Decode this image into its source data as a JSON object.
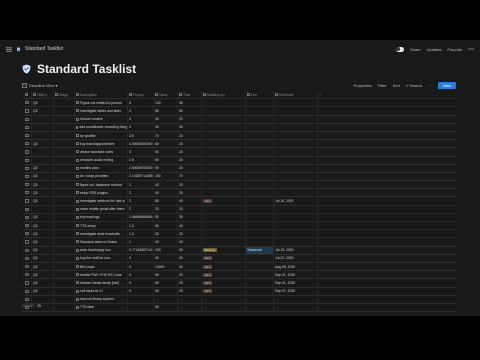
{
  "topbar": {
    "page_name": "Standard Tasklist",
    "share": "Share",
    "updates": "Updates",
    "favorite": "Favorite"
  },
  "title": "Standard Tasklist",
  "viewbar": {
    "view_name": "Deadline View",
    "properties": "Properties",
    "filter": "Filter",
    "sort": "Sort",
    "search": "Search",
    "new": "New"
  },
  "columns": {
    "check": "",
    "object": "Object",
    "stage": "Stage",
    "desc": "Description",
    "priority": "Priority",
    "value": "Value",
    "time": "Time",
    "modified": "Modified pri",
    "due": "Due",
    "reminder": "Reminder"
  },
  "rows": [
    {
      "checked": false,
      "object": "Q3",
      "stage": "",
      "desc": "Figure out related to journal",
      "priority": "5",
      "value": "100",
      "time": "35",
      "modified": "",
      "due": "",
      "reminder": "",
      "tag": ""
    },
    {
      "checked": false,
      "object": "Q3",
      "stage": "",
      "desc": "investigate tables and stats",
      "priority": "2",
      "value": "80",
      "time": "60",
      "modified": "",
      "due": "",
      "reminder": "",
      "tag": ""
    },
    {
      "checked": false,
      "object": "",
      "stage": "",
      "desc": "Unlock content",
      "priority": "4",
      "value": "40",
      "time": "20",
      "modified": "",
      "due": "",
      "reminder": "",
      "tag": ""
    },
    {
      "checked": false,
      "object": "",
      "stage": "",
      "desc": "add social/lower recording thing",
      "priority": "4",
      "value": "40",
      "time": "30",
      "modified": "",
      "due": "",
      "reminder": "",
      "tag": ""
    },
    {
      "checked": false,
      "object": "",
      "stage": "",
      "desc": "try spotlite",
      "priority": "3.5",
      "value": "70",
      "time": "20",
      "modified": "",
      "due": "",
      "reminder": "",
      "tag": ""
    },
    {
      "checked": false,
      "object": "Q3",
      "stage": "",
      "desc": "buy travel/appointment",
      "priority": "3.00000000000",
      "value": "60",
      "time": "20",
      "modified": "",
      "due": "",
      "reminder": "",
      "tag": ""
    },
    {
      "checked": false,
      "object": "",
      "stage": "",
      "desc": "weave standard notes",
      "priority": "3",
      "value": "60",
      "time": "20",
      "modified": "",
      "due": "",
      "reminder": "",
      "tag": ""
    },
    {
      "checked": false,
      "object": "",
      "stage": "",
      "desc": "research audio mixing",
      "priority": "2.5",
      "value": "50",
      "time": "20",
      "modified": "",
      "due": "",
      "reminder": "",
      "tag": ""
    },
    {
      "checked": false,
      "object": "Q3",
      "stage": "",
      "desc": "months plan",
      "priority": "2.50000000000",
      "value": "50",
      "time": "20",
      "modified": "",
      "due": "",
      "reminder": "",
      "tag": ""
    },
    {
      "checked": false,
      "object": "Q3",
      "stage": "",
      "desc": "do i swap priorities",
      "priority": "2.14285714285",
      "value": "150",
      "time": "70",
      "modified": "",
      "due": "",
      "reminder": "",
      "tag": ""
    },
    {
      "checked": false,
      "object": "Q3",
      "stage": "",
      "desc": "figure out Japanese content",
      "priority": "2",
      "value": "40",
      "time": "20",
      "modified": "",
      "due": "",
      "reminder": "",
      "tag": ""
    },
    {
      "checked": false,
      "object": "Q3",
      "stage": "",
      "desc": "setup RSS plugins",
      "priority": "2",
      "value": "40",
      "time": "20",
      "modified": "",
      "due": "",
      "reminder": "",
      "tag": ""
    },
    {
      "checked": false,
      "object": "Q3",
      "stage": "",
      "desc": "investigate webhost for dad w",
      "priority": "2",
      "value": "80",
      "time": "40",
      "modified": "Next",
      "due": "",
      "reminder": "Jul 16, 2020",
      "tag": "plain"
    },
    {
      "checked": false,
      "object": "",
      "stage": "",
      "desc": "clean mobile gmail after there",
      "priority": "2",
      "value": "20",
      "time": "10",
      "modified": "",
      "due": "",
      "reminder": "",
      "tag": ""
    },
    {
      "checked": false,
      "object": "Q3",
      "stage": "",
      "desc": "buy earplugs",
      "priority": "1.66666666666",
      "value": "50",
      "time": "30",
      "modified": "",
      "due": "",
      "reminder": "",
      "tag": ""
    },
    {
      "checked": false,
      "object": "Q3",
      "stage": "",
      "desc": "TTS setup",
      "priority": "1.5",
      "value": "60",
      "time": "40",
      "modified": "",
      "due": "",
      "reminder": "",
      "tag": ""
    },
    {
      "checked": false,
      "object": "Q3",
      "stage": "",
      "desc": "investigate desk treadmills",
      "priority": "1.5",
      "value": "30",
      "time": "20",
      "modified": "",
      "due": "",
      "reminder": "",
      "tag": ""
    },
    {
      "checked": false,
      "object": "Q3",
      "stage": "",
      "desc": "Standard tasks to Notion",
      "priority": "1",
      "value": "40",
      "time": "40",
      "modified": "",
      "due": "",
      "reminder": "",
      "tag": ""
    },
    {
      "checked": false,
      "object": "Q3",
      "stage": "",
      "desc": "work flow/happy box",
      "priority": "0.77142857142",
      "value": "100",
      "time": "35",
      "modified": "Backlog",
      "due": "Tomorrow",
      "reminder": "Jul 15, 2020",
      "tag": "gold"
    },
    {
      "checked": false,
      "object": "Q3",
      "stage": "",
      "desc": "buy the stuff for mcc",
      "priority": "0",
      "value": "60",
      "time": "30",
      "modified": "Next",
      "due": "",
      "reminder": "Jul 22, 2020",
      "tag": "plain"
    },
    {
      "checked": false,
      "object": "Q3",
      "stage": "",
      "desc": "Bill Leads",
      "priority": "0",
      "value": "10000",
      "time": "30",
      "modified": "Next",
      "due": "",
      "reminder": "Aug 05, 2020",
      "tag": "plain"
    },
    {
      "checked": false,
      "object": "Q3",
      "stage": "",
      "desc": "rewrite PWL HTW RS Code",
      "priority": "0",
      "value": "60",
      "time": "20",
      "modified": "Next",
      "due": "",
      "reminder": "Sep 01, 2020",
      "tag": "plain"
    },
    {
      "checked": false,
      "object": "Q3",
      "stage": "",
      "desc": "release Media family [sell]",
      "priority": "0",
      "value": "60",
      "time": "20",
      "modified": "Next",
      "due": "",
      "reminder": "Sep 01, 2020",
      "tag": "plain"
    },
    {
      "checked": false,
      "object": "Q3",
      "stage": "",
      "desc": "null tasks fix v1",
      "priority": "0",
      "value": "40",
      "time": "20",
      "modified": "Next",
      "due": "",
      "reminder": "Sep 07, 2020",
      "tag": "plain"
    },
    {
      "checked": false,
      "object": "",
      "stage": "",
      "desc": "new roll library system",
      "priority": "",
      "value": "",
      "time": "",
      "modified": "",
      "due": "",
      "reminder": "",
      "tag": ""
    },
    {
      "checked": false,
      "object": "",
      "stage": "",
      "desc": "TTS idea",
      "priority": "",
      "value": "30",
      "time": "",
      "modified": "",
      "due": "",
      "reminder": "",
      "tag": ""
    }
  ],
  "footer": {
    "count_label": "COUNT",
    "count": "25"
  },
  "icons": {
    "page": "page-icon",
    "tasklist": "shield-icon"
  },
  "colors": {
    "accent": "#2f7cd6",
    "tag_next": "#4a3b31",
    "tag_backlog": "#6b5a30"
  }
}
